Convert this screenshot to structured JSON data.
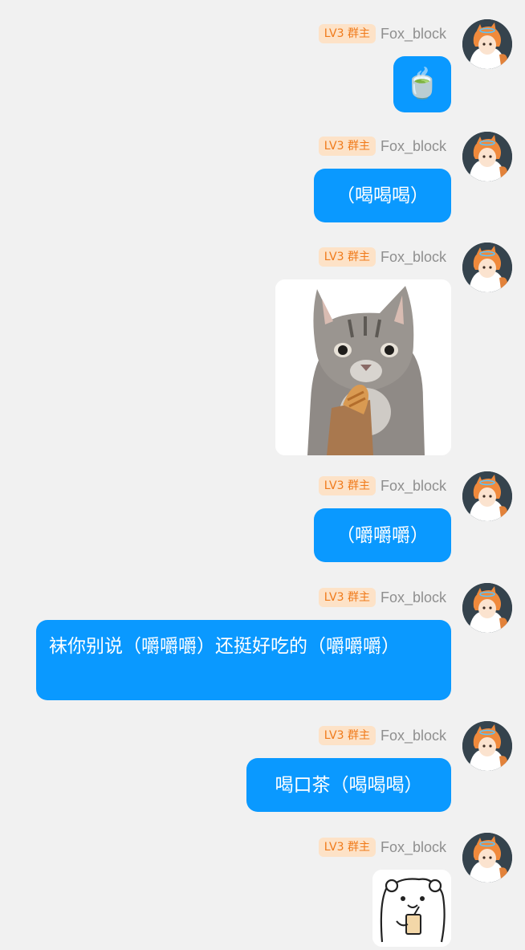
{
  "sender": {
    "level": "LV3 群主",
    "name": "Fox_block"
  },
  "messages": [
    {
      "type": "emoji",
      "emoji": "🍵",
      "icon": "tea-cup-icon"
    },
    {
      "type": "text",
      "text": "（喝喝喝）"
    },
    {
      "type": "sticker",
      "icon": "cat-eating-bread-sticker"
    },
    {
      "type": "text",
      "text": "（嚼嚼嚼）"
    },
    {
      "type": "text",
      "text": "袜你别说（嚼嚼嚼）还挺好吃的（嚼嚼嚼）"
    },
    {
      "type": "text",
      "text": "喝口茶（喝喝喝）"
    },
    {
      "type": "sticker",
      "icon": "bear-drinking-sticker"
    }
  ],
  "colors": {
    "bubble": "#0a99ff",
    "badge_bg": "#fde2c7",
    "badge_text": "#f07a1a",
    "background": "#f1f1f1"
  }
}
